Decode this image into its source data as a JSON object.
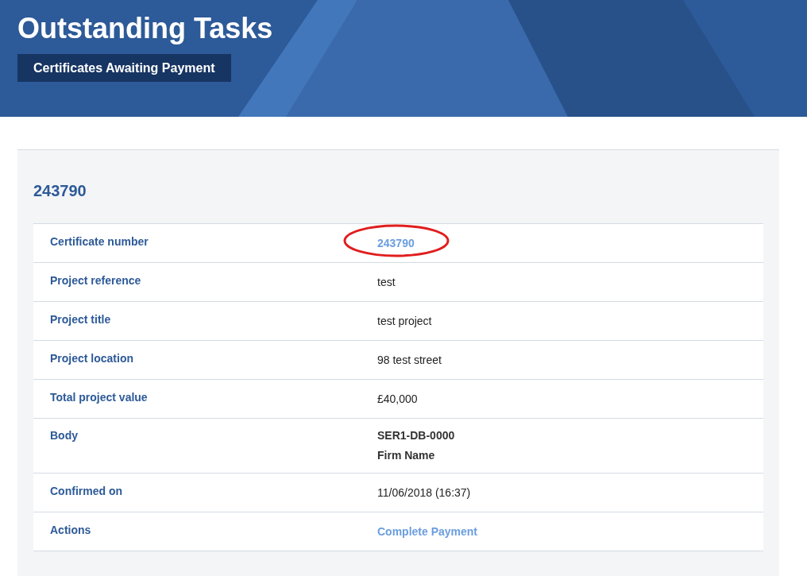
{
  "header": {
    "title": "Outstanding Tasks",
    "badge": "Certificates Awaiting Payment"
  },
  "card": {
    "heading": "243790",
    "rows": [
      {
        "label": "Certificate number",
        "kind": "link",
        "value": "243790",
        "circled": true
      },
      {
        "label": "Project reference",
        "kind": "text",
        "value": "test",
        "circled": false
      },
      {
        "label": "Project title",
        "kind": "text",
        "value": "test project",
        "circled": false
      },
      {
        "label": "Project location",
        "kind": "text",
        "value": "98 test street",
        "circled": false
      },
      {
        "label": "Total project value",
        "kind": "text",
        "value": "£40,000",
        "circled": false
      },
      {
        "label": "Body",
        "kind": "lines",
        "lines": [
          "SER1-DB-0000",
          "Firm Name"
        ],
        "circled": false
      },
      {
        "label": "Confirmed on",
        "kind": "text",
        "value": "11/06/2018 (16:37)",
        "circled": false
      },
      {
        "label": "Actions",
        "kind": "link",
        "value": "Complete Payment",
        "circled": false
      }
    ]
  }
}
